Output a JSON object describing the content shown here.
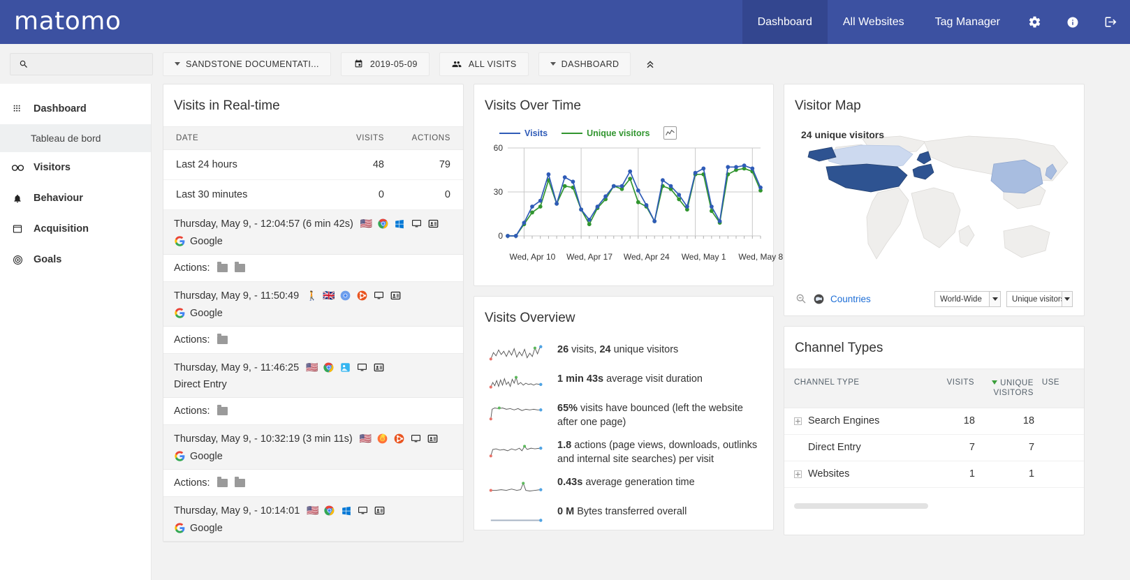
{
  "topnav": {
    "logo": "matomo",
    "items": [
      {
        "label": "Dashboard",
        "active": true
      },
      {
        "label": "All Websites",
        "active": false
      },
      {
        "label": "Tag Manager",
        "active": false
      }
    ],
    "icons": [
      "gear-icon",
      "info-icon",
      "logout-icon"
    ]
  },
  "toolbar": {
    "search_placeholder": "",
    "search_value": "",
    "site_selector": "SANDSTONE DOCUMENTATI...",
    "date_selector": "2019-05-09",
    "segment_selector": "ALL VISITS",
    "dashboard_selector": "DASHBOARD"
  },
  "sidebar": {
    "items": [
      {
        "label": "Dashboard",
        "icon": "grid-icon",
        "active": false
      },
      {
        "label": "Tableau de bord",
        "icon": "",
        "sub": true,
        "active": true
      },
      {
        "label": "Visitors",
        "icon": "binoculars-icon",
        "active": false
      },
      {
        "label": "Behaviour",
        "icon": "bell-icon",
        "active": false
      },
      {
        "label": "Acquisition",
        "icon": "window-icon",
        "active": false
      },
      {
        "label": "Goals",
        "icon": "target-icon",
        "active": false
      }
    ]
  },
  "realtime": {
    "title": "Visits in Real-time",
    "columns": [
      "DATE",
      "VISITS",
      "ACTIONS"
    ],
    "summary_rows": [
      {
        "date": "Last 24 hours",
        "visits": "48",
        "actions": "79"
      },
      {
        "date": "Last 30 minutes",
        "visits": "0",
        "actions": "0"
      }
    ],
    "visits": [
      {
        "time": "Thursday, May 9, - 12:04:57 (6 min 42s)",
        "flag": "🇺🇸",
        "browser": "chrome-icon",
        "os": "windows-icon",
        "device": "desktop-icon",
        "profile": "visitor-profile-icon",
        "referrer": "Google",
        "referrer_icon": "google-icon",
        "actions_label": "Actions:",
        "action_count": 2
      },
      {
        "time": "Thursday, May 9, - 11:50:49",
        "flag": "🇬🇧",
        "browser": "chromium-icon",
        "os": "ubuntu-icon",
        "device": "desktop-icon",
        "profile": "visitor-profile-icon",
        "referrer": "Google",
        "referrer_icon": "google-icon",
        "actions_label": "Actions:",
        "action_count": 1
      },
      {
        "time": "Thursday, May 9, - 11:46:25",
        "flag": "🇺🇸",
        "browser": "chrome-icon",
        "os": "mac-icon",
        "device": "desktop-icon",
        "profile": "visitor-profile-icon",
        "referrer": "Direct Entry",
        "referrer_icon": "",
        "actions_label": "Actions:",
        "action_count": 1
      },
      {
        "time": "Thursday, May 9, - 10:32:19 (3 min 11s)",
        "flag": "🇺🇸",
        "browser": "firefox-icon",
        "os": "ubuntu-icon",
        "device": "desktop-icon",
        "profile": "visitor-profile-icon",
        "referrer": "Google",
        "referrer_icon": "google-icon",
        "actions_label": "Actions:",
        "action_count": 2
      },
      {
        "time": "Thursday, May 9, - 10:14:01",
        "flag": "🇺🇸",
        "browser": "chrome-icon",
        "os": "windows-icon",
        "device": "desktop-icon",
        "profile": "visitor-profile-icon",
        "referrer": "Google",
        "referrer_icon": "google-icon",
        "actions_label": "Actions:",
        "action_count": 0
      }
    ]
  },
  "visits_over_time": {
    "title": "Visits Over Time"
  },
  "visits_overview": {
    "title": "Visits Overview",
    "rows": [
      {
        "value": "26",
        "value2": "24",
        "text_a": " visits, ",
        "text_b": " unique visitors",
        "sparkline": "visits-sparkline"
      },
      {
        "value": "1 min 43s",
        "value2": "",
        "text_a": " average visit duration",
        "text_b": "",
        "sparkline": "duration-sparkline"
      },
      {
        "value": "65%",
        "value2": "",
        "text_a": " visits have bounced (left the website after one page)",
        "text_b": "",
        "sparkline": "bounce-sparkline"
      },
      {
        "value": "1.8",
        "value2": "",
        "text_a": " actions (page views, downloads, outlinks and internal site searches) per visit",
        "text_b": "",
        "sparkline": "actions-sparkline"
      },
      {
        "value": "0.43s",
        "value2": "",
        "text_a": " average generation time",
        "text_b": "",
        "sparkline": "gentime-sparkline"
      },
      {
        "value": "0 M",
        "value2": "",
        "text_a": " Bytes transferred overall",
        "text_b": "",
        "sparkline": "bytes-sparkline"
      }
    ]
  },
  "visitor_map": {
    "title": "Visitor Map",
    "overlay_label": "24 unique visitors",
    "countries_link": "Countries",
    "region_select": "World-Wide",
    "metric_select": "Unique visitors"
  },
  "channel_types": {
    "title": "Channel Types",
    "columns": [
      "CHANNEL TYPE",
      "VISITS",
      "UNIQUE VISITORS",
      "USE"
    ],
    "sorted_column": "UNIQUE VISITORS",
    "rows": [
      {
        "name": "Search Engines",
        "expandable": true,
        "visits": "18",
        "unique_visitors": "18"
      },
      {
        "name": "Direct Entry",
        "expandable": false,
        "visits": "7",
        "unique_visitors": "7"
      },
      {
        "name": "Websites",
        "expandable": true,
        "visits": "1",
        "unique_visitors": "1"
      }
    ]
  },
  "colors": {
    "brand": "#3c51a1",
    "brand_active": "#33468f",
    "visits_line": "#2f5bb7",
    "unique_line": "#31952f",
    "link": "#1e6ed6",
    "map_dark": "#2e5391",
    "map_mid": "#a8bde0",
    "map_light": "#ccd9ef",
    "map_base": "#efeeec"
  },
  "chart_data": {
    "type": "line",
    "title": "Visits Over Time",
    "xlabel": "",
    "ylabel": "",
    "ylim": [
      0,
      60
    ],
    "yticks": [
      0,
      30,
      60
    ],
    "grid": true,
    "legend_position": "top-left",
    "tick_labels": [
      "Wed, Apr 10",
      "Wed, Apr 17",
      "Wed, Apr 24",
      "Wed, May 1",
      "Wed, May 8"
    ],
    "x": [
      "Apr 8",
      "Apr 9",
      "Apr 10",
      "Apr 11",
      "Apr 12",
      "Apr 13",
      "Apr 14",
      "Apr 15",
      "Apr 16",
      "Apr 17",
      "Apr 18",
      "Apr 19",
      "Apr 20",
      "Apr 21",
      "Apr 22",
      "Apr 23",
      "Apr 24",
      "Apr 25",
      "Apr 26",
      "Apr 27",
      "Apr 28",
      "Apr 29",
      "Apr 30",
      "May 1",
      "May 2",
      "May 3",
      "May 4",
      "May 5",
      "May 6",
      "May 7",
      "May 8",
      "May 9"
    ],
    "series": [
      {
        "name": "Visits",
        "color": "#2f5bb7",
        "values": [
          0,
          0,
          9,
          20,
          24,
          42,
          22,
          40,
          37,
          18,
          11,
          20,
          27,
          34,
          34,
          44,
          31,
          21,
          10,
          38,
          34,
          28,
          20,
          43,
          46,
          20,
          10,
          47,
          47,
          48,
          46,
          33
        ]
      },
      {
        "name": "Unique visitors",
        "color": "#31952f",
        "values": [
          0,
          0,
          8,
          16,
          20,
          38,
          22,
          34,
          33,
          18,
          8,
          19,
          25,
          34,
          32,
          39,
          23,
          20,
          10,
          34,
          32,
          25,
          18,
          42,
          42,
          17,
          9,
          42,
          45,
          46,
          44,
          31
        ]
      }
    ]
  }
}
